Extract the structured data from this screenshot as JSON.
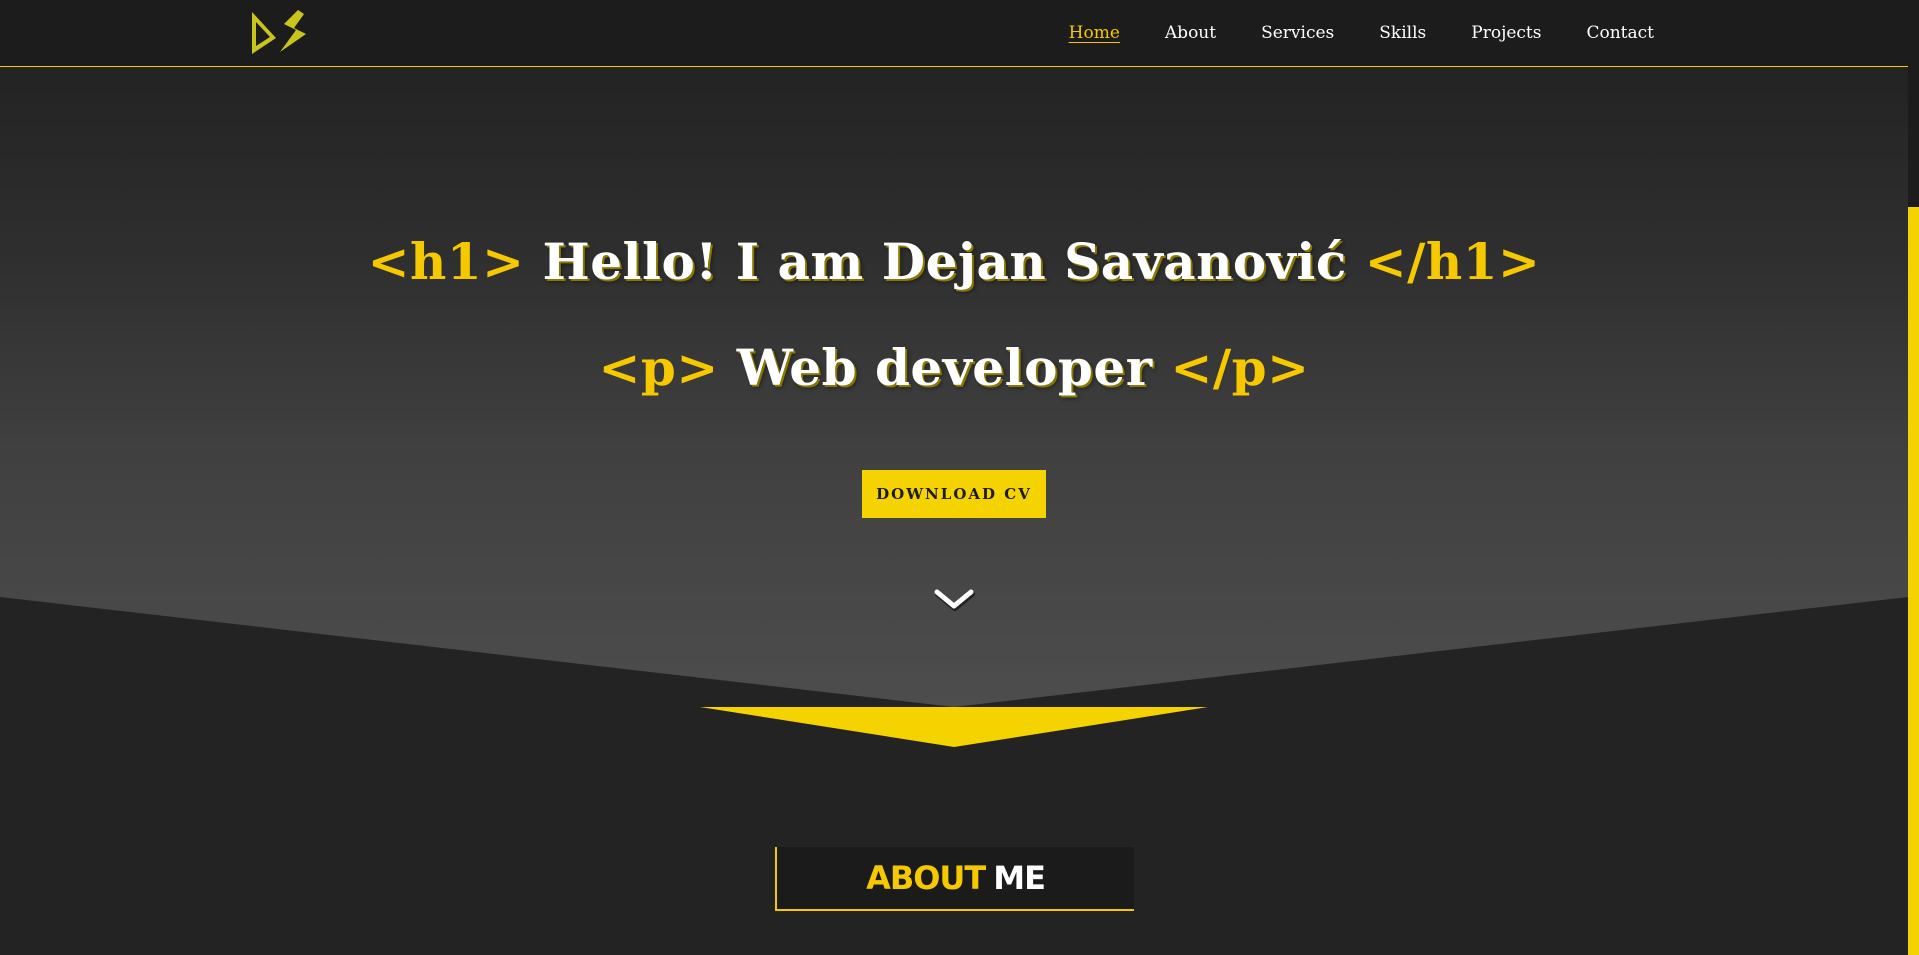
{
  "nav": {
    "logo_text": "DS",
    "items": [
      {
        "label": "Home",
        "active": true
      },
      {
        "label": "About",
        "active": false
      },
      {
        "label": "Services",
        "active": false
      },
      {
        "label": "Skills",
        "active": false
      },
      {
        "label": "Projects",
        "active": false
      },
      {
        "label": "Contact",
        "active": false
      }
    ]
  },
  "hero": {
    "line1": {
      "open_tag": "<h1>",
      "text": "Hello! I am Dejan Savanović",
      "close_tag": "</h1>"
    },
    "line2": {
      "open_tag": "<p>",
      "text": "Web developer",
      "close_tag": "</p>"
    },
    "button_label": "DOWNLOAD CV",
    "scroll_icon": "chevron-down-icon"
  },
  "about": {
    "accent": "ABOUT",
    "rest": "ME"
  },
  "colors": {
    "accent": "#f5c800",
    "background": "#232324",
    "navbar": "#1c1c1c",
    "text": "#ffffff"
  }
}
